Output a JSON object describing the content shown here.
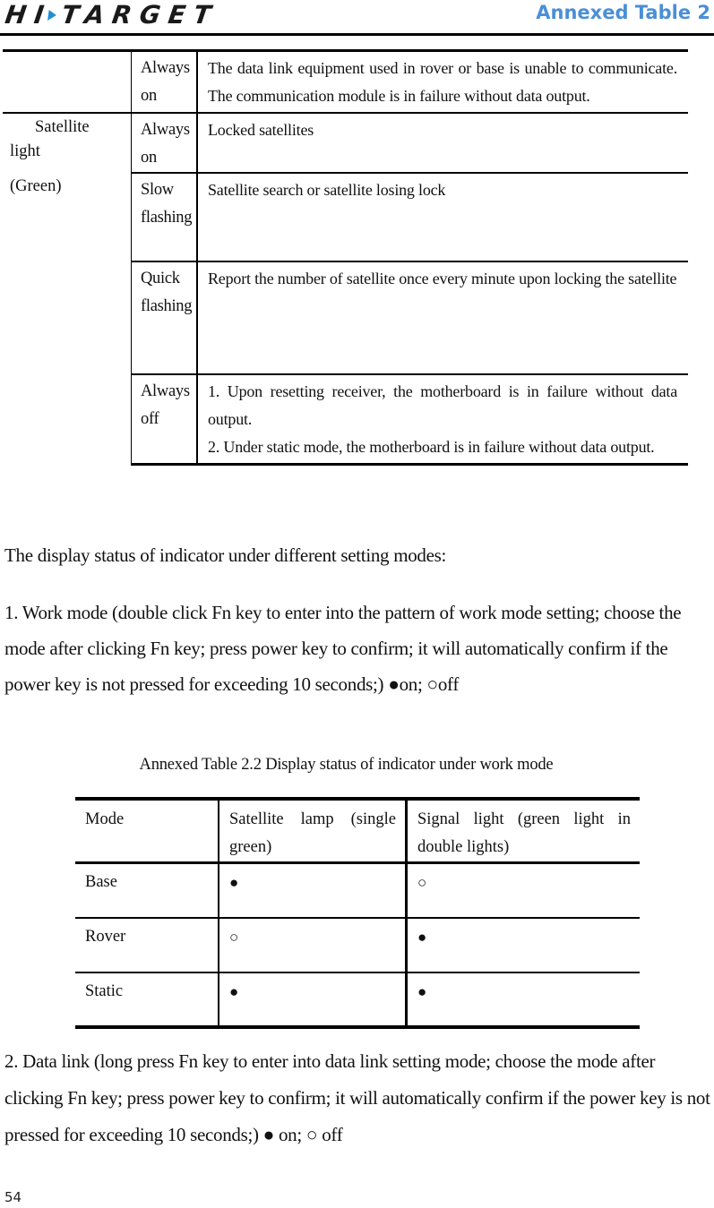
{
  "header": {
    "logo_text_left": "HI",
    "logo_text_right": "TARGET",
    "title": "Annexed Table 2",
    "title_color": "#4a8fd6",
    "logo_accent_color": "#1e8fd6"
  },
  "table1": {
    "rows": [
      {
        "light": "",
        "status": "Always on",
        "description": "The data link equipment used in rover or base is unable to communicate. The communication module is in failure without data output."
      },
      {
        "light_line1": "Satellite",
        "light_line2": "light",
        "light_line3": "(Green)",
        "status": "Always on",
        "description": "Locked satellites"
      },
      {
        "status": "Slow flashing",
        "description": "Satellite search or satellite losing lock"
      },
      {
        "status": "Quick flashing",
        "description": "Report the number of satellite once every minute upon locking the satellite"
      },
      {
        "status": "Always off",
        "description_line1": "1. Upon resetting receiver, the motherboard is in failure without data output.",
        "description_line2": "2. Under static mode, the motherboard is in failure without data output."
      }
    ]
  },
  "intro": "The display status of indicator under different setting modes:",
  "work_mode": "1. Work mode (double click Fn key to enter into the pattern of work mode setting; choose the mode after clicking Fn key; press power key to confirm; it will automatically confirm if the power key is not pressed for exceeding 10 seconds;) ●on; ○off",
  "table2": {
    "caption": "Annexed Table 2.2 Display status of indicator under work mode",
    "headers": [
      "Mode",
      "Satellite lamp (single green)",
      "Signal light (green light in double lights)"
    ],
    "rows": [
      {
        "mode": "Base",
        "satellite": "●",
        "signal": "○"
      },
      {
        "mode": "Rover",
        "satellite": "○",
        "signal": "●"
      },
      {
        "mode": "Static",
        "satellite": "●",
        "signal": "●"
      }
    ],
    "legend": {
      "on": "●",
      "off": "○"
    }
  },
  "data_link": "2. Data link (long press Fn key to enter into data link setting mode; choose the mode after clicking Fn key; press power key to confirm; it will automatically confirm if the power key is not pressed for exceeding 10 seconds;) ● on; ○ off",
  "page_number": "54"
}
